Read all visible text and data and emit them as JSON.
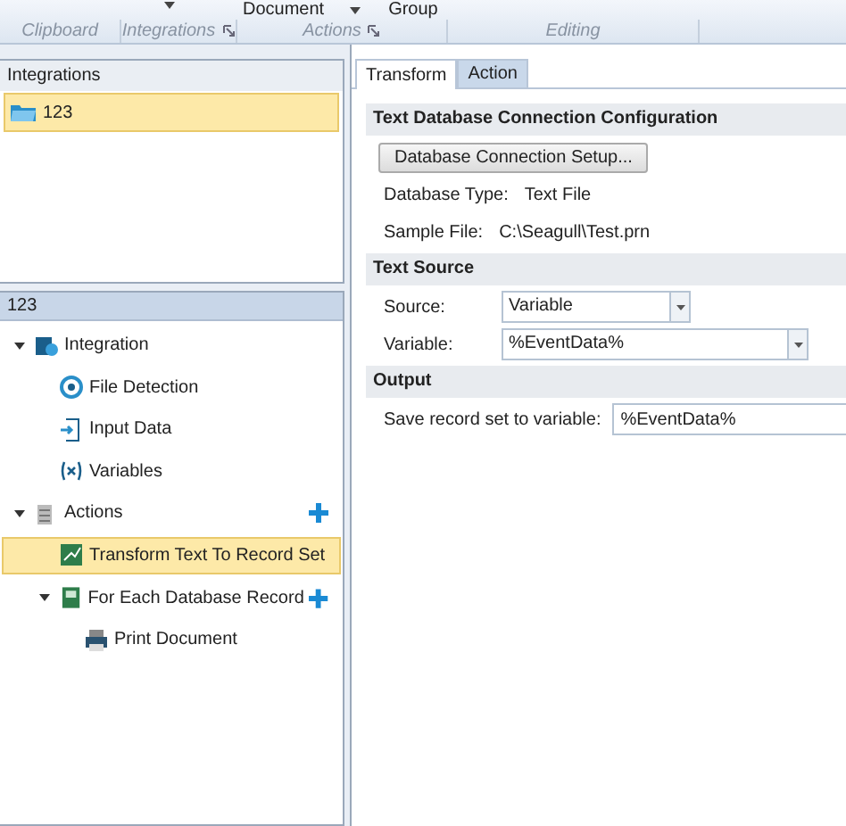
{
  "ribbon": {
    "buttons": [
      {
        "label": "Document",
        "kind": "dropdown"
      },
      {
        "label": "Group",
        "kind": "plain"
      }
    ],
    "groups": [
      {
        "label": "Clipboard",
        "launcher": false
      },
      {
        "label": "Integrations",
        "launcher": true
      },
      {
        "label": "Actions",
        "launcher": true
      },
      {
        "label": "Editing",
        "launcher": false
      }
    ]
  },
  "integrations": {
    "title": "Integrations",
    "items": [
      {
        "label": "123",
        "selected": true
      }
    ]
  },
  "tree": {
    "title": "123",
    "items": [
      {
        "label": "Integration",
        "expanded": true,
        "selected": false,
        "addable": false,
        "children": [
          {
            "label": "File Detection",
            "selected": false,
            "addable": false
          },
          {
            "label": "Input Data",
            "selected": false,
            "addable": false
          },
          {
            "label": "Variables",
            "selected": false,
            "addable": false
          }
        ]
      },
      {
        "label": "Actions",
        "expanded": true,
        "selected": false,
        "addable": true,
        "children": [
          {
            "label": "Transform Text To Record Set",
            "selected": true,
            "addable": false
          },
          {
            "label": "For Each Database Record",
            "expanded": true,
            "selected": false,
            "addable": true,
            "children": [
              {
                "label": "Print Document",
                "selected": false,
                "addable": false
              }
            ]
          }
        ]
      }
    ]
  },
  "tabs": [
    {
      "label": "Transform",
      "selected": true
    },
    {
      "label": "Action",
      "selected": false
    }
  ],
  "sections": [
    {
      "title": "Text Database Connection Configuration",
      "rows": [
        {
          "kind": "button",
          "label": "Database Connection Setup..."
        },
        {
          "kind": "info",
          "label": "Database Type:",
          "value": "Text File"
        },
        {
          "kind": "info",
          "label": "Sample File:",
          "value": "C:\\Seagull\\Test.prn"
        }
      ]
    },
    {
      "title": "Text Source",
      "rows": [
        {
          "kind": "select",
          "label": "Source:",
          "value": "Variable",
          "wide": false
        },
        {
          "kind": "select",
          "label": "Variable:",
          "value": "%EventData%",
          "wide": true
        }
      ]
    },
    {
      "title": "Output",
      "rows": [
        {
          "kind": "input",
          "label": "Save record set to variable:",
          "value": "%EventData%"
        }
      ]
    }
  ]
}
